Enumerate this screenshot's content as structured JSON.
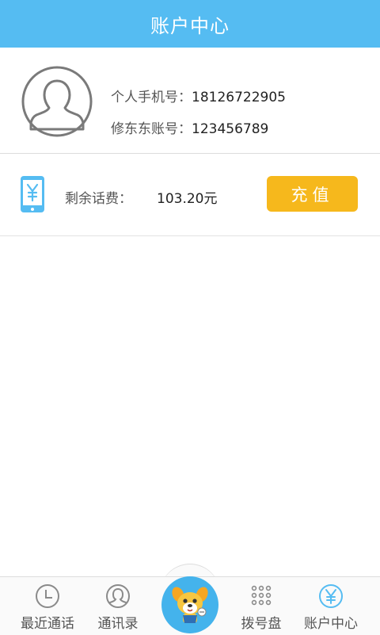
{
  "header": {
    "title": "账户中心"
  },
  "profile": {
    "phone_label": "个人手机号：",
    "phone_value": "18126722905",
    "account_label": "修东东账号：",
    "account_value": "123456789"
  },
  "balance": {
    "label": "剩余话费：",
    "value": "103.20元",
    "icon": "phone-yen-icon",
    "recharge_label": "充值"
  },
  "tabs": [
    {
      "label": "最近通话",
      "icon": "clock-icon"
    },
    {
      "label": "通讯录",
      "icon": "contact-icon"
    },
    {
      "label": "",
      "icon": "mascot-dog-icon"
    },
    {
      "label": "拨号盘",
      "icon": "dialpad-icon"
    },
    {
      "label": "账户中心",
      "icon": "yen-circle-icon"
    }
  ],
  "colors": {
    "primary": "#55bcf2",
    "recharge": "#f6b81c",
    "icon_gray": "#8a8a8a"
  }
}
